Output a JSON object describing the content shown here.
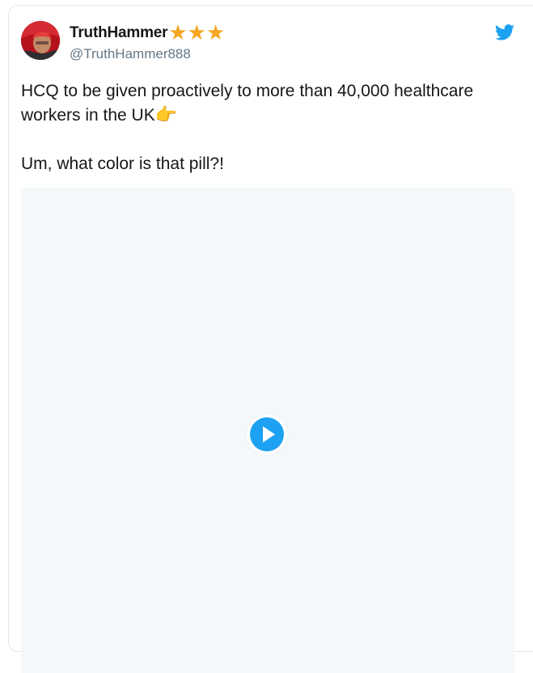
{
  "tweet": {
    "display_name": "TruthHammer",
    "name_badges": "★★★",
    "handle": "@TruthHammer888",
    "text_line1": "HCQ to be given proactively to more than 40,000 healthcare workers in the UK",
    "text_emoji": "👉",
    "text_line2": "Um, what color is that pill?!"
  },
  "icons": {
    "brand": "twitter-bird-icon",
    "play": "play-icon",
    "badge": "star-icon",
    "pointer": "backhand-index-pointing-right-icon"
  },
  "colors": {
    "brand_blue": "#1da1f2",
    "text": "#14171a",
    "muted": "#657786",
    "star": "#f5a623",
    "media_bg": "#f5f8fa",
    "border": "#e1e8ed"
  }
}
